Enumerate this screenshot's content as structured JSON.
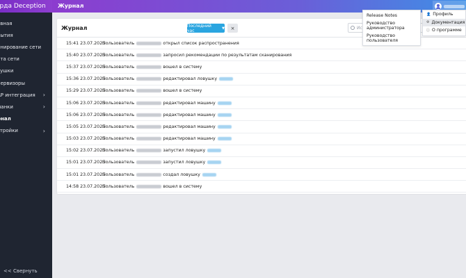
{
  "app": {
    "brand": "арда Deception"
  },
  "header": {
    "title": "Журнал"
  },
  "sidebar": {
    "items": [
      {
        "label": "авная",
        "has_children": false,
        "active": false
      },
      {
        "label": "бытия",
        "has_children": false,
        "active": false
      },
      {
        "label": "анирование сети",
        "has_children": false,
        "active": false
      },
      {
        "label": "рта сети",
        "has_children": false,
        "active": false
      },
      {
        "label": "вушки",
        "has_children": false,
        "active": false
      },
      {
        "label": "первизоры",
        "has_children": false,
        "active": false
      },
      {
        "label": "AP интеграция",
        "has_children": true,
        "active": false
      },
      {
        "label": "манки",
        "has_children": true,
        "active": false
      },
      {
        "label": "рнал",
        "has_children": false,
        "active": true
      },
      {
        "label": "стройки",
        "has_children": true,
        "active": false
      }
    ],
    "collapse_label": "<< Свернуть"
  },
  "journal": {
    "title": "Журнал",
    "period_label": "Последний час",
    "clear_label": "×",
    "search_placeholder": "Ис",
    "rows": [
      {
        "time": "15:41 23.07.2025",
        "user_label": "Пользователь",
        "action": "открыл список распространения",
        "has_target": false
      },
      {
        "time": "15:40 23.07.2025",
        "user_label": "Пользователь",
        "action": "запросил рекомендации по результатам сканирования",
        "has_target": false
      },
      {
        "time": "15:37 23.07.2025",
        "user_label": "Пользователь",
        "action": "вошел в систему",
        "has_target": false
      },
      {
        "time": "15:36 23.07.2025",
        "user_label": "Пользователь",
        "action": "редактировал ловушку",
        "has_target": true
      },
      {
        "time": "15:29 23.07.2025",
        "user_label": "Пользователь",
        "action": "вошел в систему",
        "has_target": false
      },
      {
        "time": "15:06 23.07.2025",
        "user_label": "Пользователь",
        "action": "редактировал машину",
        "has_target": true
      },
      {
        "time": "15:06 23.07.2025",
        "user_label": "Пользователь",
        "action": "редактировал машину",
        "has_target": true
      },
      {
        "time": "15:05 23.07.2025",
        "user_label": "Пользователь",
        "action": "редактировал машину",
        "has_target": true
      },
      {
        "time": "15:03 23.07.2025",
        "user_label": "Пользователь",
        "action": "редактировал машину",
        "has_target": true
      },
      {
        "time": "15:02 23.07.2025",
        "user_label": "Пользователь",
        "action": "запустил ловушку",
        "has_target": true
      },
      {
        "time": "15:01 23.07.2025",
        "user_label": "Пользователь",
        "action": "запустил ловушку",
        "has_target": true
      },
      {
        "time": "15:01 23.07.2025",
        "user_label": "Пользователь",
        "action": "создал ловушку",
        "has_target": true
      },
      {
        "time": "14:58 23.07.2025",
        "user_label": "Пользователь",
        "action": "вошел в систему",
        "has_target": false
      }
    ]
  },
  "docs_menu": {
    "items": [
      {
        "label": "Release Notes"
      },
      {
        "label": "Руководство администратора"
      },
      {
        "label": "Руководство пользователя"
      }
    ]
  },
  "user_menu": {
    "items": [
      {
        "label": "Профиль",
        "icon": "person-icon"
      },
      {
        "label": "Документация",
        "icon": "doc-icon"
      },
      {
        "label": "О программе",
        "icon": "info-icon"
      }
    ]
  },
  "colors": {
    "sidebar_bg": "#1f2531",
    "header_gradient_start": "#8c3ccf",
    "header_gradient_end": "#3f8fe6",
    "period_button": "#2aa5e0"
  }
}
